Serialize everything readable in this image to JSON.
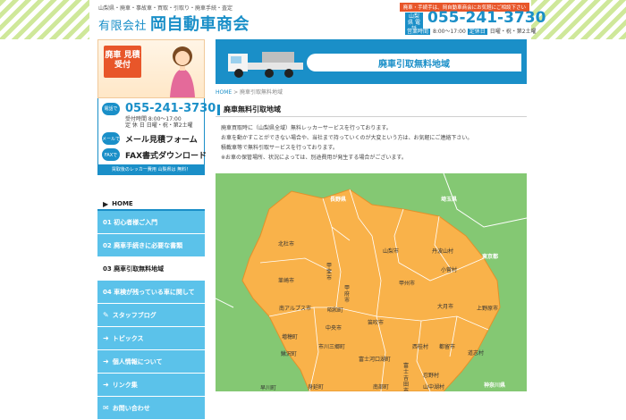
{
  "header": {
    "tagline": "山梨県・廃車・事故車・買取・引取り・廃車手続・査定",
    "company_prefix": "有限会社",
    "company_name": "岡自動車商会",
    "notice": "廃車・手続手は、岡自動車商会にお気軽にご相談下さい",
    "phone_label": "山梨県 電話",
    "phone": "055-241-3730",
    "hours_tag": "営業時間",
    "hours": "8:00～17:00",
    "closed_tag": "定休日",
    "closed": "日曜・祝・第2土曜"
  },
  "sidebar": {
    "promo_badge": "廃車 見積受付",
    "phone_pill": "電話で",
    "phone": "055-241-3730",
    "hours_line1": "受付時間 8:00～17:00",
    "hours_line2": "定 休 日 日曜・祝・第2土曜",
    "mail_pill": "メールで",
    "mail_label": "メール見積フォーム",
    "fax_pill": "FAXで",
    "fax_label": "FAX書式ダウンロード",
    "band": "買取後のレッカー費用 山梨県は 無料！",
    "nav": [
      {
        "label": "HOME",
        "kind": "home"
      },
      {
        "label": "01 初心者様ご入門",
        "kind": "item"
      },
      {
        "label": "02 廃車手続きに必要な書類",
        "kind": "item"
      },
      {
        "label": "03 廃車引取無料地域",
        "kind": "active"
      },
      {
        "label": "04 車検が残っている車に関して",
        "kind": "item"
      },
      {
        "label": "スタッフブログ",
        "kind": "item"
      },
      {
        "label": "トピックス",
        "kind": "item"
      },
      {
        "label": "個人情報について",
        "kind": "item"
      },
      {
        "label": "リンク集",
        "kind": "item"
      },
      {
        "label": "お問い合わせ",
        "kind": "item"
      }
    ]
  },
  "main": {
    "banner_title": "廃車引取無料地域",
    "crumb_home": "HOME",
    "crumb_sep": " > ",
    "crumb_current": "廃車引取無料地域",
    "heading": "廃車無料引取地域",
    "paragraph": [
      "廃車買取時に（山梨県全域）無料レッカーサービスを行っております。",
      "お車を動かすことができない場合や、当社まで持っていくのが大変という方は、お気軽にご連絡下さい。",
      "積載車等で無料引取サービスを行っております。",
      "※お車の保管場所、状況によっては、別途費用が発生する場合がございます。"
    ]
  },
  "map": {
    "outer": [
      "長野県",
      "埼玉県",
      "東京都",
      "神奈川県"
    ],
    "cities": [
      "北杜市",
      "山梨市",
      "丹波山村",
      "韮崎市",
      "甲斐市",
      "小菅村",
      "甲州市",
      "甲府市",
      "南アルプス市",
      "昭和町",
      "大月市",
      "上野原市",
      "中央市",
      "笛吹市",
      "増穂町",
      "市川三郷町",
      "西桂村",
      "都留市",
      "道志村",
      "富士河口湖町",
      "鰍沢町",
      "早川町",
      "身延町",
      "忍野村",
      "山中湖村",
      "富士吉田市",
      "南部町"
    ]
  },
  "colors": {
    "accent": "#1a8fc8",
    "nav": "#5bc2ea",
    "map_land": "#f9b24a",
    "map_outside": "#84c873",
    "alert": "#e8562a"
  }
}
